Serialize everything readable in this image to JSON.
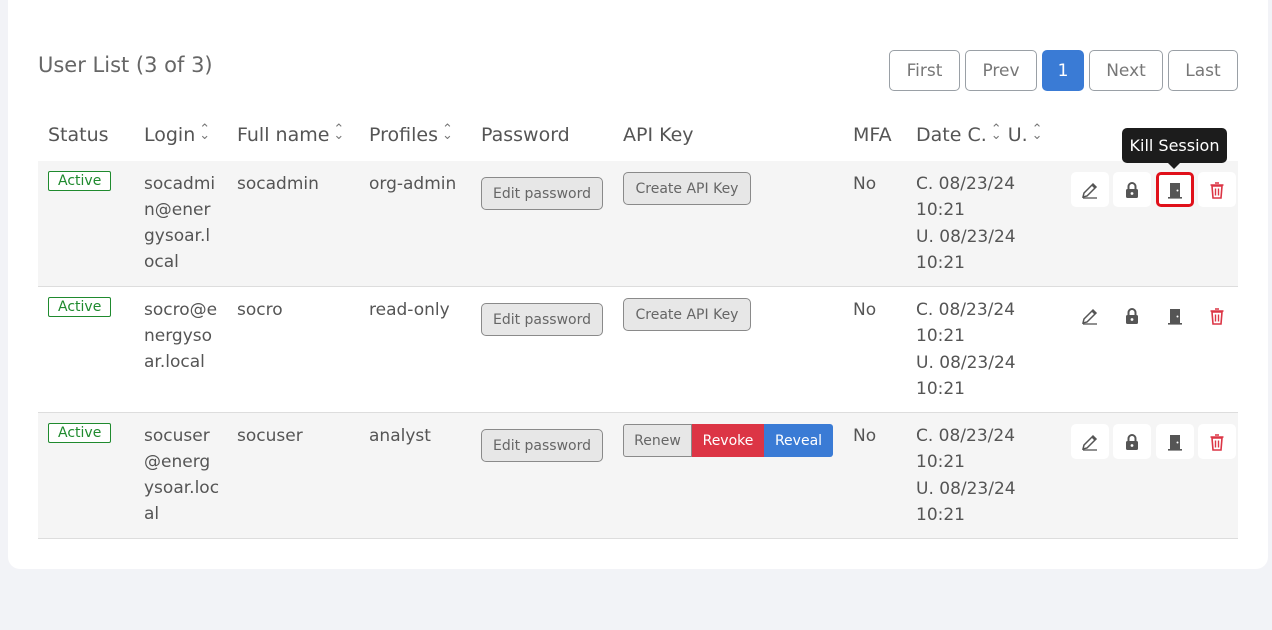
{
  "title": "User List (3 of 3)",
  "pagination": {
    "first": "First",
    "prev": "Prev",
    "current": "1",
    "next": "Next",
    "last": "Last"
  },
  "columns": {
    "status": "Status",
    "login": "Login",
    "fullname": "Full name",
    "profiles": "Profiles",
    "password": "Password",
    "apikey": "API Key",
    "mfa": "MFA",
    "dates": "Date C.",
    "updated": "U."
  },
  "tooltip": "Kill Session",
  "rows": [
    {
      "status": "Active",
      "login": "socadmin@energysoar.local",
      "fullname": "socadmin",
      "profile": "org-admin",
      "password_btn": "Edit password",
      "api_btn": "Create API Key",
      "mfa": "No",
      "created": "C. 08/23/24 10:21",
      "updated": "U. 08/23/24 10:21"
    },
    {
      "status": "Active",
      "login": "socro@energysoar.local",
      "fullname": "socro",
      "profile": "read-only",
      "password_btn": "Edit password",
      "api_btn": "Create API Key",
      "mfa": "No",
      "created": "C. 08/23/24 10:21",
      "updated": "U. 08/23/24 10:21"
    },
    {
      "status": "Active",
      "login": "socuser@energysoar.local",
      "fullname": "socuser",
      "profile": "analyst",
      "password_btn": "Edit password",
      "api_renew": "Renew",
      "api_revoke": "Revoke",
      "api_reveal": "Reveal",
      "mfa": "No",
      "created": "C. 08/23/24 10:21",
      "updated": "U. 08/23/24 10:21"
    }
  ],
  "icons": {
    "edit": "pencil-icon",
    "lock": "lock-icon",
    "kill": "door-icon",
    "delete": "trash-icon"
  },
  "colors": {
    "active": "#1f8a2e",
    "primary": "#3a7bd5",
    "danger": "#dc3545"
  }
}
